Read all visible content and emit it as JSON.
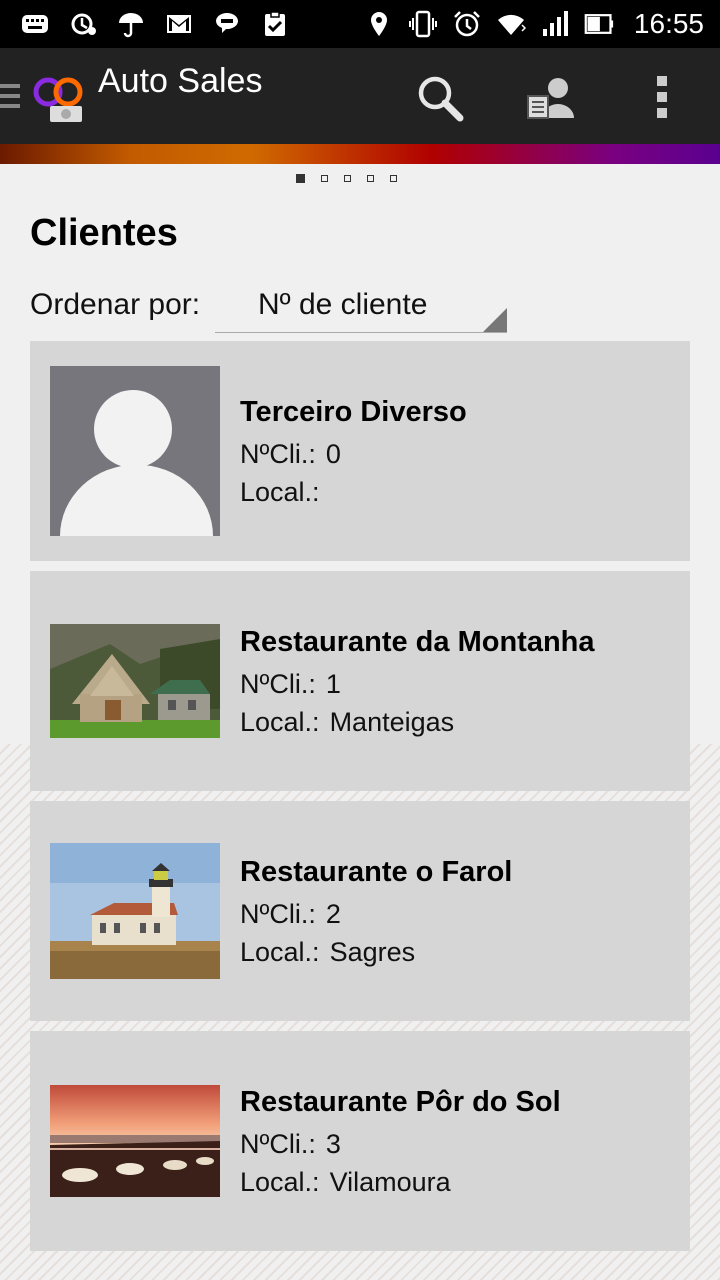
{
  "status_bar": {
    "time": "16:55",
    "icons": [
      "keyboard-icon",
      "sync-icon",
      "umbrella-icon",
      "gmail-icon",
      "hangouts-icon",
      "clipboard-check-icon",
      "location-icon",
      "vibrate-icon",
      "alarm-icon",
      "wifi-icon",
      "signal-icon",
      "battery-icon"
    ]
  },
  "action_bar": {
    "title": "Auto Sales",
    "colors": {
      "background": "#222222"
    }
  },
  "pager": {
    "count": 5,
    "active": 1
  },
  "page": {
    "title": "Clientes"
  },
  "sort": {
    "label": "Ordenar por:",
    "value": "Nº de cliente"
  },
  "clients": [
    {
      "name": "Terceiro Diverso",
      "num_label": "NºCli.:",
      "num": "0",
      "local_label": "Local.:",
      "local": "",
      "image": "default-avatar"
    },
    {
      "name": "Restaurante da Montanha",
      "num_label": "NºCli.:",
      "num": "1",
      "local_label": "Local.:",
      "local": "Manteigas",
      "image": "stone-chapel-photo"
    },
    {
      "name": "Restaurante o Farol",
      "num_label": "NºCli.:",
      "num": "2",
      "local_label": "Local.:",
      "local": "Sagres",
      "image": "lighthouse-photo"
    },
    {
      "name": "Restaurante Pôr do Sol",
      "num_label": "NºCli.:",
      "num": "3",
      "local_label": "Local.:",
      "local": "Vilamoura",
      "image": "sunset-terrace-photo"
    }
  ]
}
